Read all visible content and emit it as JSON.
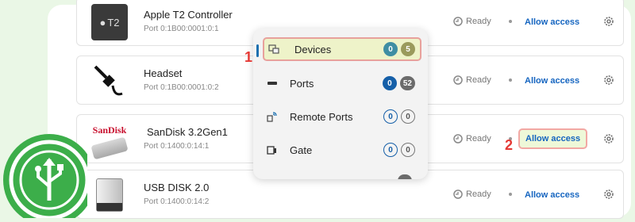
{
  "devices": [
    {
      "name": "Apple T2 Controller",
      "port": "Port 0:1B00:0001:0:1",
      "status": "Ready",
      "action": "Allow access",
      "thumb_text": "T2"
    },
    {
      "name": "Headset",
      "port": "Port 0:1B00:0001:0:2",
      "status": "Ready",
      "action": "Allow access"
    },
    {
      "name": "SanDisk 3.2Gen1",
      "port": "Port 0:1400:0:14:1",
      "status": "Ready",
      "action": "Allow access",
      "brand": "SanDisk"
    },
    {
      "name": "USB DISK 2.0",
      "port": "Port 0:1400:0:14:2",
      "status": "Ready",
      "action": "Allow access"
    }
  ],
  "menu": {
    "items": [
      {
        "label": "Devices",
        "badge_a": "0",
        "badge_b": "5"
      },
      {
        "label": "Ports",
        "badge_a": "0",
        "badge_b": "52"
      },
      {
        "label": "Remote Ports",
        "badge_a": "0",
        "badge_b": "0"
      },
      {
        "label": "Gate",
        "badge_a": "0",
        "badge_b": "0"
      }
    ]
  },
  "markers": {
    "one": "1",
    "two": "2"
  },
  "colors": {
    "accent": "#1565c0",
    "highlight_border": "#e8a19c",
    "brand_green": "#3cae4a"
  }
}
